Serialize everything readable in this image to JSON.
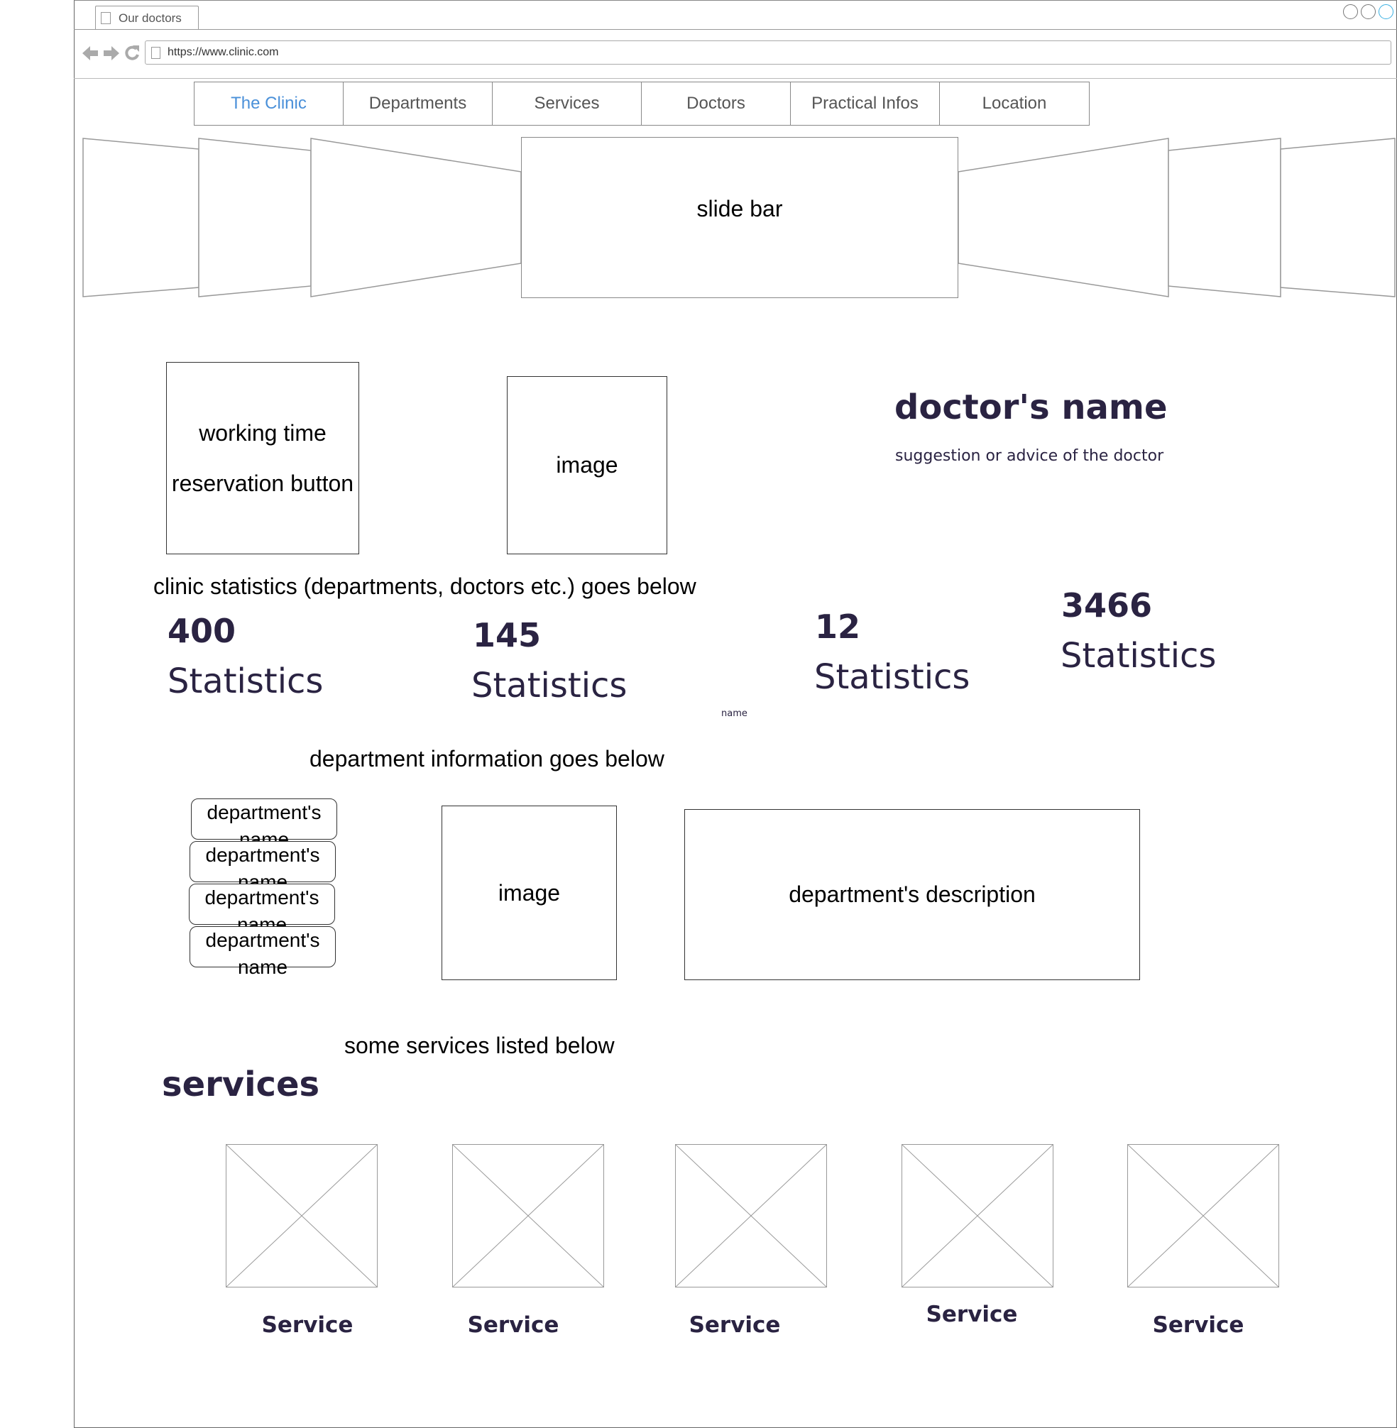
{
  "browser": {
    "tab_title": "Our doctors",
    "url": "https://www.clinic.com"
  },
  "menu": {
    "items": [
      {
        "label": "The Clinic",
        "active": true
      },
      {
        "label": "Departments"
      },
      {
        "label": "Services"
      },
      {
        "label": "Doctors"
      },
      {
        "label": "Practical Infos"
      },
      {
        "label": "Location"
      }
    ]
  },
  "slider": {
    "label": "slide bar"
  },
  "working_box": {
    "line1": "working time",
    "line2": "reservation button"
  },
  "doctor_image": {
    "label": "image"
  },
  "doctor": {
    "name": "doctor's name",
    "advice": "suggestion or advice of the doctor"
  },
  "stats": {
    "heading": "clinic statistics (departments, doctors etc.) goes below",
    "items": [
      {
        "value": "400",
        "label": "Statistics"
      },
      {
        "value": "145",
        "label": "Statistics"
      },
      {
        "value": "12",
        "label": "Statistics"
      },
      {
        "value": "3466",
        "label": "Statistics"
      }
    ],
    "stray_label": "name"
  },
  "departments": {
    "heading": "department information goes below",
    "items": [
      {
        "label": "department's name"
      },
      {
        "label": "department's name"
      },
      {
        "label": "department's name"
      },
      {
        "label": "department's name"
      }
    ],
    "image_label": "image",
    "description": "department's description"
  },
  "services": {
    "note": "some services listed below",
    "title": "services",
    "items": [
      {
        "label": "Service"
      },
      {
        "label": "Service"
      },
      {
        "label": "Service"
      },
      {
        "label": "Service"
      },
      {
        "label": "Service"
      }
    ]
  },
  "colors": {
    "accent": "#4a90d9",
    "heading_dark": "#2a2342",
    "window_active": "#3ab0e2"
  }
}
